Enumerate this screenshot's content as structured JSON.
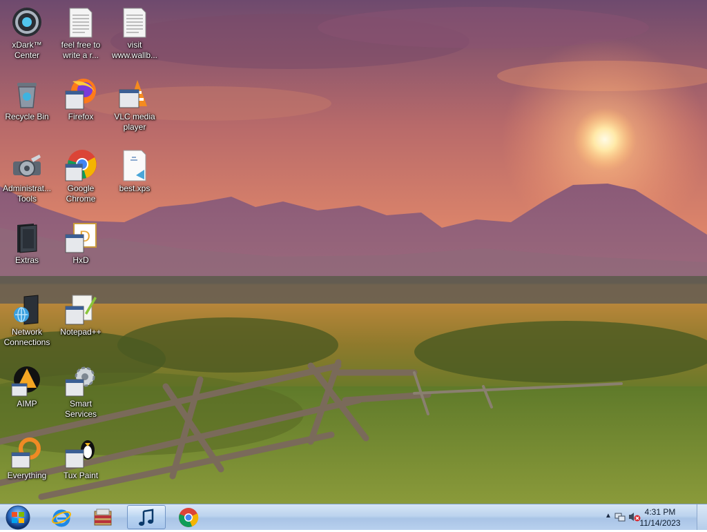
{
  "desktop": {
    "icons": [
      {
        "id": "xdark",
        "label": "xDark™ Center",
        "icon": "xdark-icon"
      },
      {
        "id": "feel",
        "label": "feel free to write a r...",
        "icon": "text-document-icon"
      },
      {
        "id": "visit",
        "label": "visit www.wallb...",
        "icon": "text-document-icon"
      },
      {
        "id": "recycle",
        "label": "Recycle Bin",
        "icon": "recycle-bin-icon"
      },
      {
        "id": "firefox",
        "label": "Firefox",
        "icon": "firefox-icon"
      },
      {
        "id": "vlc",
        "label": "VLC media player",
        "icon": "vlc-icon"
      },
      {
        "id": "admin",
        "label": "Administrat... Tools",
        "icon": "admin-tools-icon"
      },
      {
        "id": "chrome",
        "label": "Google Chrome",
        "icon": "chrome-icon"
      },
      {
        "id": "best",
        "label": "best.xps",
        "icon": "xps-document-icon"
      },
      {
        "id": "extras",
        "label": "Extras",
        "icon": "folder-icon"
      },
      {
        "id": "hxd",
        "label": "HxD",
        "icon": "hxd-icon"
      },
      {
        "id": "network",
        "label": "Network Connections",
        "icon": "network-icon"
      },
      {
        "id": "notepad",
        "label": "Notepad++",
        "icon": "notepad-icon"
      },
      {
        "id": "aimp",
        "label": "AIMP",
        "icon": "aimp-icon"
      },
      {
        "id": "smart",
        "label": "Smart Services",
        "icon": "gear-icon"
      },
      {
        "id": "everything",
        "label": "Everything",
        "icon": "search-icon"
      },
      {
        "id": "tux",
        "label": "Tux Paint",
        "icon": "tux-icon"
      }
    ]
  },
  "taskbar": {
    "pinned": [
      {
        "id": "ie",
        "icon": "internet-explorer-icon"
      },
      {
        "id": "explorer",
        "icon": "file-explorer-icon"
      },
      {
        "id": "aimp",
        "icon": "music-note-icon",
        "active": true
      },
      {
        "id": "chrome",
        "icon": "chrome-icon"
      }
    ],
    "clock": {
      "time": "4:31 PM",
      "date": "11/14/2023"
    }
  }
}
